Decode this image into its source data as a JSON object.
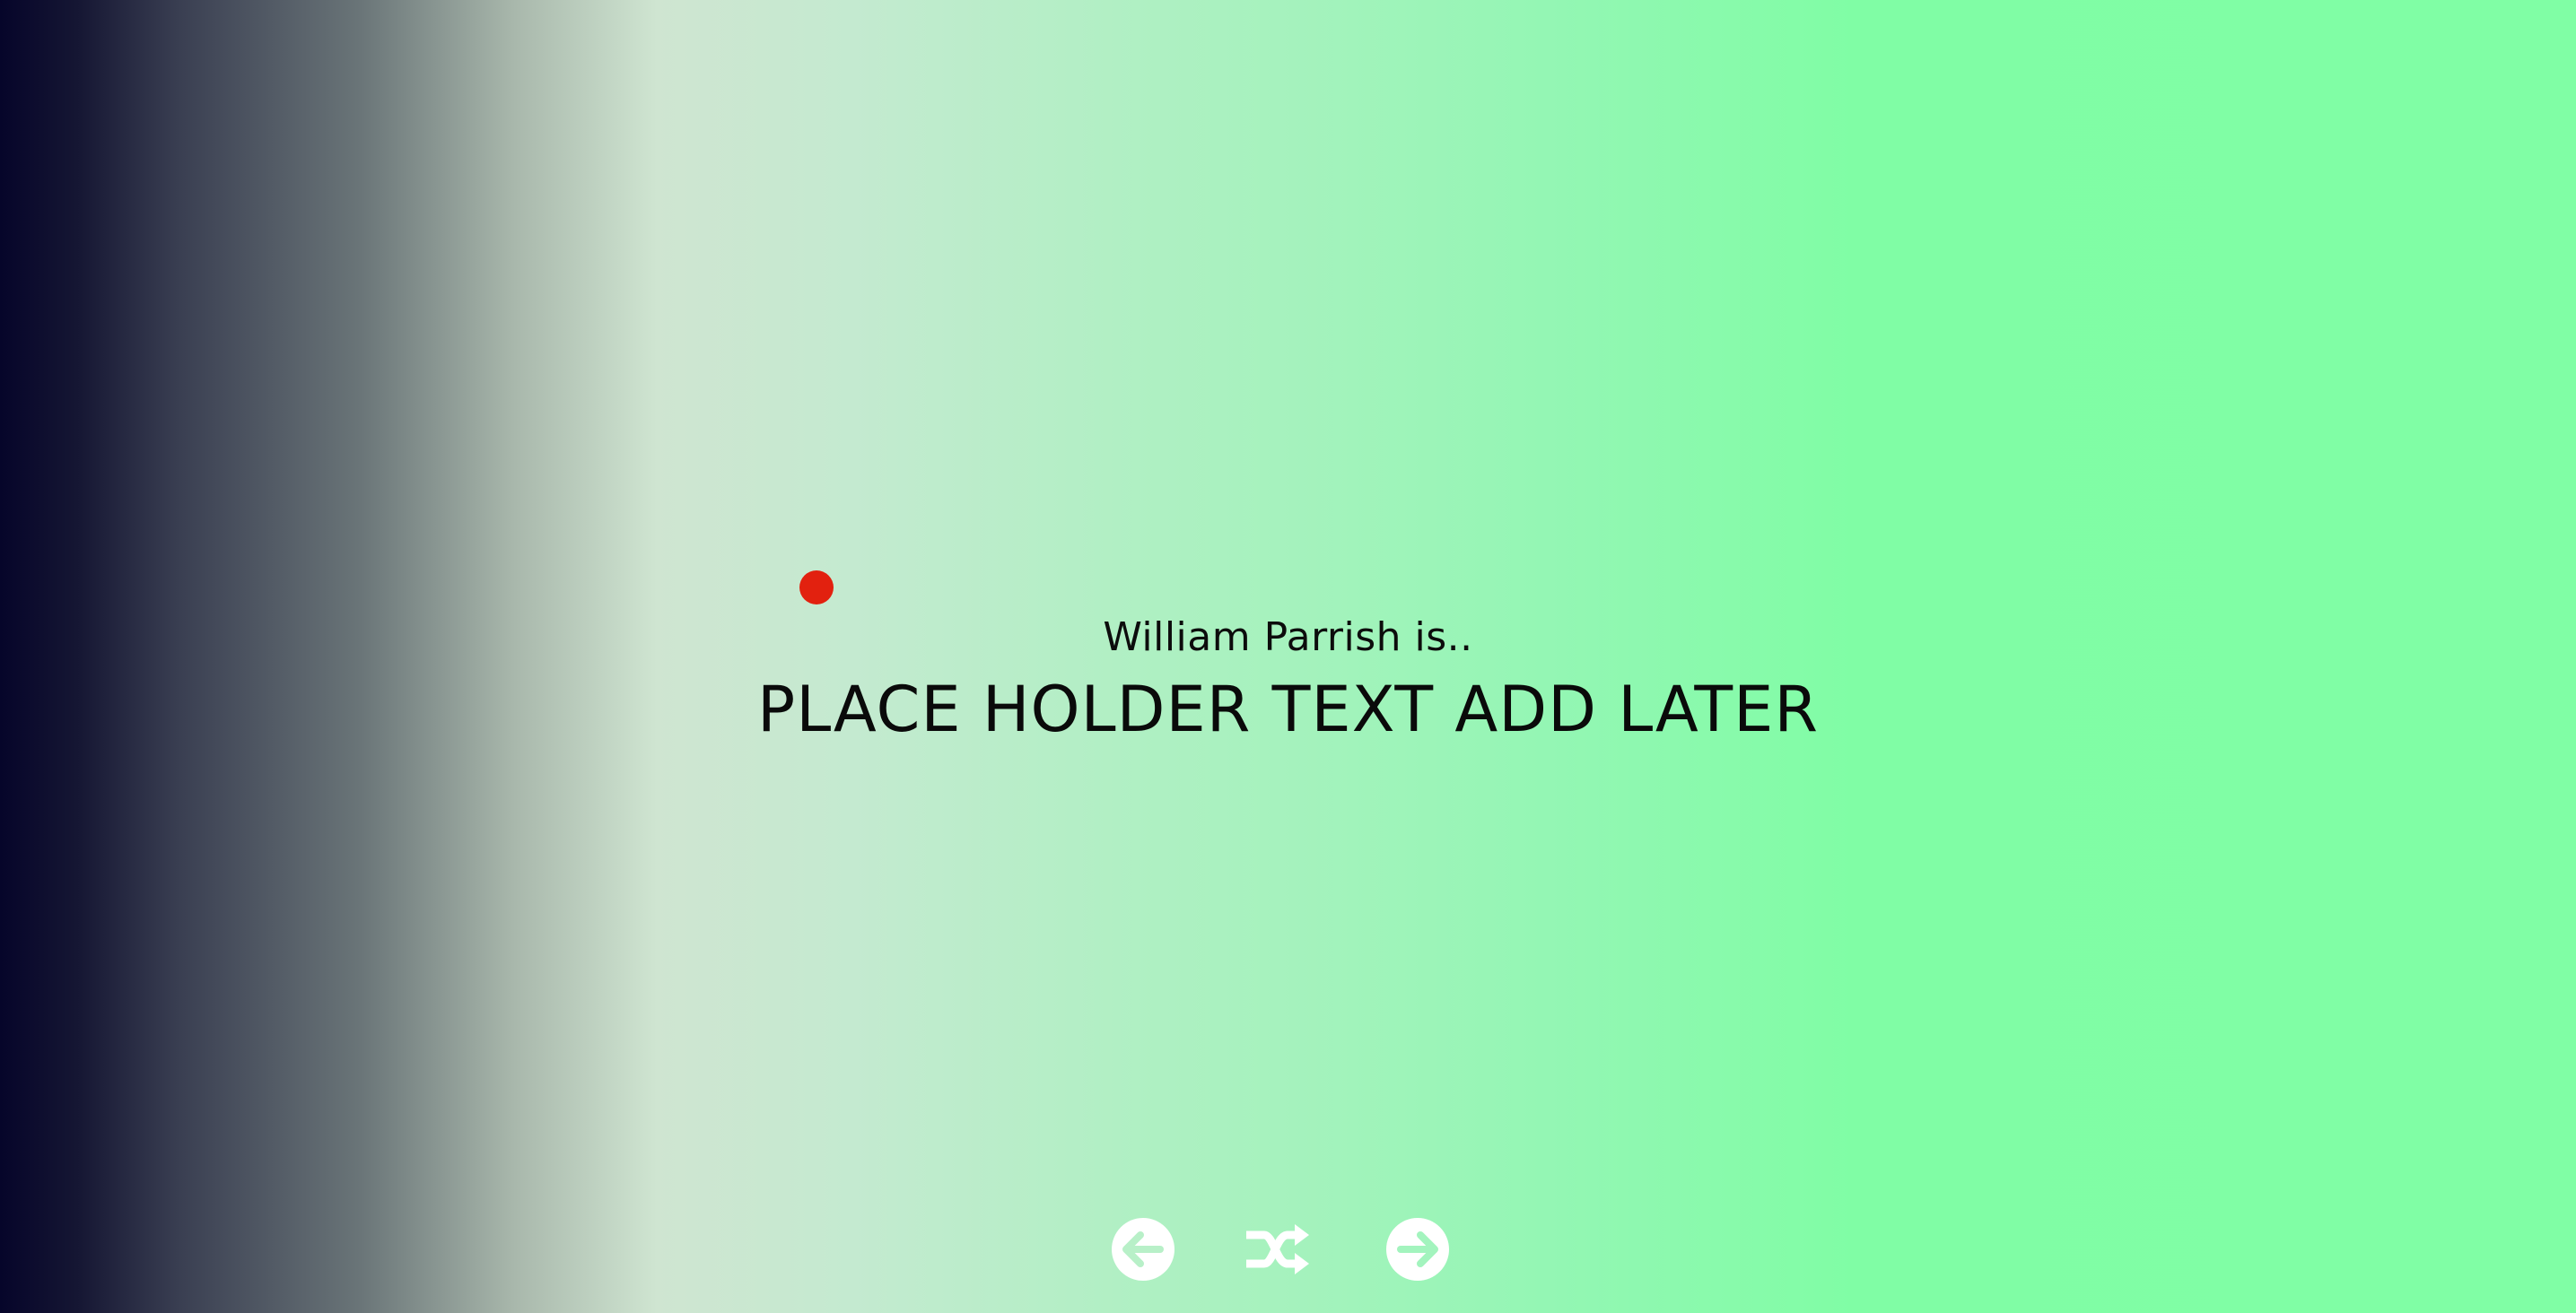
{
  "intro": {
    "lead_text": "William Parrish is..",
    "headline_text": "PLACE HOLDER TEXT ADD LATER"
  },
  "controls": {
    "previous_icon": "arrow-left-circle-icon",
    "shuffle_icon": "shuffle-icon",
    "next_icon": "arrow-right-circle-icon"
  },
  "colors": {
    "indicator_dot": "#e2210f",
    "control_icons": "#ffffff",
    "text": "#0a0a0a",
    "gradient_start": "#06052a",
    "gradient_end": "#80fea5"
  }
}
